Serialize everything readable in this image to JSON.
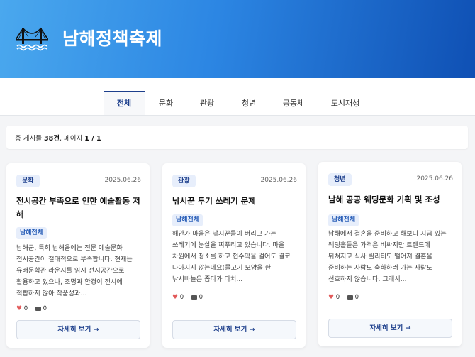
{
  "header": {
    "title": "남해정책축제",
    "logo_icon": "bridge-icon"
  },
  "tabs": [
    {
      "label": "전체",
      "active": true
    },
    {
      "label": "문화"
    },
    {
      "label": "관광"
    },
    {
      "label": "청년"
    },
    {
      "label": "공동체"
    },
    {
      "label": "도시재생"
    }
  ],
  "summary": {
    "prefix": "총 게시물 ",
    "count": "38건",
    "mid": ", 페이지 ",
    "page": "1 / 1"
  },
  "cards": [
    {
      "category": "문화",
      "date": "2025.06.26",
      "title": "전시공간 부족으로 인한 예술활동 저해",
      "tag": "남해전체",
      "body": "남해군, 특히 남해읍에는 전문 예술문화 전시공간이 절대적으로 부족합니다. 현재는 유배문학관 라운지를 임시 전시공간으로 활용하고 있으나, 조명과 환경이 전시에 적합하지 않아 작품성과...",
      "likes": "0",
      "comments": "0",
      "more_label": "자세히 보기"
    },
    {
      "category": "관광",
      "date": "2025.06.26",
      "title": "낚시꾼 투기 쓰레기 문제",
      "tag": "남해전체",
      "body": "해안가 마을은 낚시꾼들이 버리고 가는 쓰레기에 눈살을 찌푸리고 있습니다. 마을 차원에서 청소를 하고 현수막을 걸어도 결코 나아지지 않는데요(물고기 모양을 한 낚시바늘은 좁다가 다치...",
      "likes": "0",
      "comments": "0",
      "more_label": "자세히 보기"
    },
    {
      "category": "청년",
      "date": "2025.06.26",
      "title": "남해 공공 웨딩문화 기획 및 조성",
      "tag": "남해전체",
      "body": "남해에서 결혼을 준비하고 해보니 지금 있는 웨딩홀들은 가격은 비싸지만 트렌드에 뒤쳐지고 식사 퀄리티도 떨어져 결혼을 준비하는 사람도 축하하러 가는 사람도 선호하지 않습니다. 그래서...",
      "likes": "0",
      "comments": "0",
      "more_label": "자세히 보기"
    }
  ],
  "colors": {
    "accent": "#1d3f8c",
    "header_start": "#4aa8ee",
    "header_end": "#0f50b4",
    "heart": "#e25a5a"
  }
}
